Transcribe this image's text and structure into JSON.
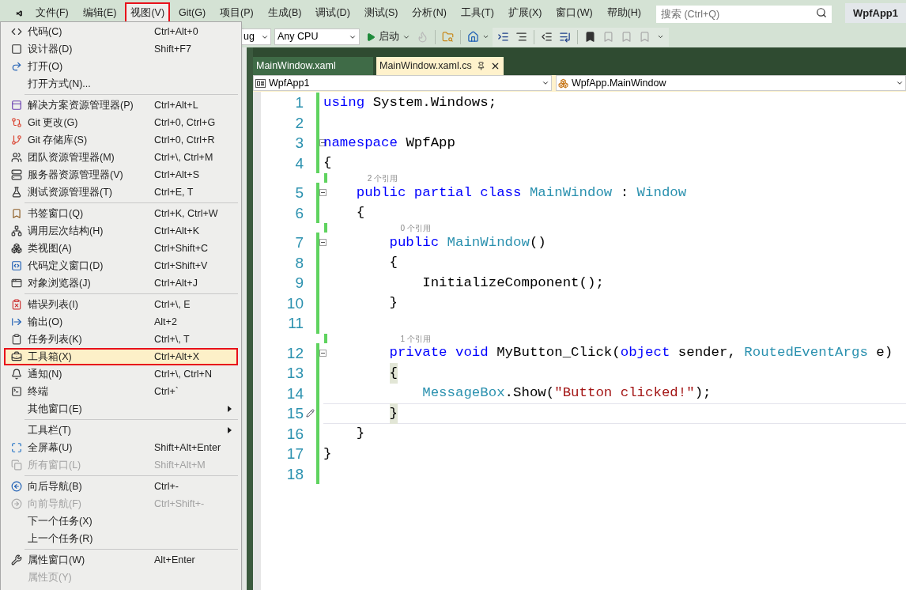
{
  "menubar": {
    "items": [
      {
        "label": "文件(F)",
        "selected": false
      },
      {
        "label": "编辑(E)",
        "selected": false
      },
      {
        "label": "视图(V)",
        "selected": true
      },
      {
        "label": "Git(G)",
        "selected": false
      },
      {
        "label": "项目(P)",
        "selected": false
      },
      {
        "label": "生成(B)",
        "selected": false
      },
      {
        "label": "调试(D)",
        "selected": false
      },
      {
        "label": "测试(S)",
        "selected": false
      },
      {
        "label": "分析(N)",
        "selected": false
      },
      {
        "label": "工具(T)",
        "selected": false
      },
      {
        "label": "扩展(X)",
        "selected": false
      },
      {
        "label": "窗口(W)",
        "selected": false
      },
      {
        "label": "帮助(H)",
        "selected": false
      }
    ],
    "search": {
      "placeholder": "搜索 (Ctrl+Q)"
    },
    "solution": "WpfApp1"
  },
  "toolbar": {
    "configuration": "ug",
    "platform": "Any CPU",
    "start": "启动"
  },
  "view_menu": {
    "items": [
      {
        "kind": "item",
        "label": "代码(C)",
        "shortcut": "Ctrl+Alt+0",
        "disabled": false,
        "selected": false
      },
      {
        "kind": "item",
        "label": "设计器(D)",
        "shortcut": "Shift+F7",
        "disabled": false,
        "selected": false
      },
      {
        "kind": "item",
        "label": "打开(O)",
        "disabled": false,
        "selected": false
      },
      {
        "kind": "item",
        "label": "打开方式(N)...",
        "disabled": false,
        "selected": false
      },
      {
        "kind": "separator"
      },
      {
        "kind": "item",
        "label": "解决方案资源管理器(P)",
        "shortcut": "Ctrl+Alt+L",
        "disabled": false,
        "selected": false
      },
      {
        "kind": "item",
        "label": "Git 更改(G)",
        "shortcut": "Ctrl+0, Ctrl+G",
        "disabled": false,
        "selected": false
      },
      {
        "kind": "item",
        "label": "Git 存储库(S)",
        "shortcut": "Ctrl+0, Ctrl+R",
        "disabled": false,
        "selected": false
      },
      {
        "kind": "item",
        "label": "团队资源管理器(M)",
        "shortcut": "Ctrl+\\, Ctrl+M",
        "disabled": false,
        "selected": false
      },
      {
        "kind": "item",
        "label": "服务器资源管理器(V)",
        "shortcut": "Ctrl+Alt+S",
        "disabled": false,
        "selected": false
      },
      {
        "kind": "item",
        "label": "测试资源管理器(T)",
        "shortcut": "Ctrl+E, T",
        "disabled": false,
        "selected": false
      },
      {
        "kind": "separator"
      },
      {
        "kind": "item",
        "label": "书签窗口(Q)",
        "shortcut": "Ctrl+K, Ctrl+W",
        "disabled": false,
        "selected": false
      },
      {
        "kind": "item",
        "label": "调用层次结构(H)",
        "shortcut": "Ctrl+Alt+K",
        "disabled": false,
        "selected": false
      },
      {
        "kind": "item",
        "label": "类视图(A)",
        "shortcut": "Ctrl+Shift+C",
        "disabled": false,
        "selected": false
      },
      {
        "kind": "item",
        "label": "代码定义窗口(D)",
        "shortcut": "Ctrl+Shift+V",
        "disabled": false,
        "selected": false
      },
      {
        "kind": "item",
        "label": "对象浏览器(J)",
        "shortcut": "Ctrl+Alt+J",
        "disabled": false,
        "selected": false
      },
      {
        "kind": "separator"
      },
      {
        "kind": "item",
        "label": "错误列表(I)",
        "shortcut": "Ctrl+\\, E",
        "disabled": false,
        "selected": false
      },
      {
        "kind": "item",
        "label": "输出(O)",
        "shortcut": "Alt+2",
        "disabled": false,
        "selected": false
      },
      {
        "kind": "item",
        "label": "任务列表(K)",
        "shortcut": "Ctrl+\\, T",
        "disabled": false,
        "selected": false
      },
      {
        "kind": "item",
        "label": "工具箱(X)",
        "shortcut": "Ctrl+Alt+X",
        "disabled": false,
        "selected": true
      },
      {
        "kind": "item",
        "label": "通知(N)",
        "shortcut": "Ctrl+\\, Ctrl+N",
        "disabled": false,
        "selected": false
      },
      {
        "kind": "item",
        "label": "终端",
        "shortcut": "Ctrl+`",
        "disabled": false,
        "selected": false
      },
      {
        "kind": "item",
        "label": "其他窗口(E)",
        "submenu": true,
        "disabled": false,
        "selected": false
      },
      {
        "kind": "separator"
      },
      {
        "kind": "item",
        "label": "工具栏(T)",
        "submenu": true,
        "disabled": false,
        "selected": false
      },
      {
        "kind": "item",
        "label": "全屏幕(U)",
        "shortcut": "Shift+Alt+Enter",
        "disabled": false,
        "selected": false
      },
      {
        "kind": "item",
        "label": "所有窗口(L)",
        "shortcut": "Shift+Alt+M",
        "disabled": true,
        "selected": false
      },
      {
        "kind": "separator"
      },
      {
        "kind": "item",
        "label": "向后导航(B)",
        "shortcut": "Ctrl+-",
        "disabled": false,
        "selected": false
      },
      {
        "kind": "item",
        "label": "向前导航(F)",
        "shortcut": "Ctrl+Shift+-",
        "disabled": true,
        "selected": false
      },
      {
        "kind": "item",
        "label": "下一个任务(X)",
        "disabled": false,
        "selected": false
      },
      {
        "kind": "item",
        "label": "上一个任务(R)",
        "disabled": false,
        "selected": false
      },
      {
        "kind": "separator"
      },
      {
        "kind": "item",
        "label": "属性窗口(W)",
        "shortcut": "Alt+Enter",
        "disabled": false,
        "selected": false
      },
      {
        "kind": "item",
        "label": "属性页(Y)",
        "disabled": true,
        "selected": false
      }
    ]
  },
  "tabs": [
    {
      "label": "MainWindow.xaml",
      "selected": false
    },
    {
      "label": "MainWindow.xaml.cs",
      "selected": true
    }
  ],
  "navigation": {
    "project": "WpfApp1",
    "type": "WpfApp.MainWindow"
  },
  "editor": {
    "lines": [
      {
        "number": "1",
        "tokens": [
          {
            "kind": "keyword",
            "text": "using"
          },
          {
            "kind": "plain",
            "text": " System.Windows;"
          }
        ]
      },
      {
        "number": "2"
      },
      {
        "number": "3",
        "foldable": true,
        "tokens": [
          {
            "kind": "keyword",
            "text": "namespace"
          },
          {
            "kind": "plain",
            "text": " WpfApp"
          }
        ]
      },
      {
        "number": "4",
        "tokens": [
          {
            "kind": "plain",
            "text": "{"
          }
        ]
      },
      {
        "number": "5",
        "foldable": true,
        "codelens": "2 个引用",
        "tokens": [
          {
            "kind": "keyword",
            "text": "    public partial class"
          },
          {
            "kind": "type",
            "text": " MainWindow"
          },
          {
            "kind": "plain",
            "text": " :"
          },
          {
            "kind": "type",
            "text": " Window"
          }
        ]
      },
      {
        "number": "6",
        "tokens": [
          {
            "kind": "plain",
            "text": "    {"
          }
        ]
      },
      {
        "number": "7",
        "foldable": true,
        "codelens": "0 个引用",
        "tokens": [
          {
            "kind": "keyword",
            "text": "        public"
          },
          {
            "kind": "type",
            "text": " MainWindow"
          },
          {
            "kind": "plain",
            "text": "()"
          }
        ]
      },
      {
        "number": "8",
        "tokens": [
          {
            "kind": "plain",
            "text": "        {"
          }
        ]
      },
      {
        "number": "9",
        "tokens": [
          {
            "kind": "plain",
            "text": "            InitializeComponent();"
          }
        ]
      },
      {
        "number": "10",
        "tokens": [
          {
            "kind": "plain",
            "text": "        }"
          }
        ]
      },
      {
        "number": "11"
      },
      {
        "number": "12",
        "foldable": true,
        "codelens": "1 个引用",
        "tokens": [
          {
            "kind": "keyword",
            "text": "        private void"
          },
          {
            "kind": "plain",
            "text": " MyButton_Click("
          },
          {
            "kind": "keyword",
            "text": "object"
          },
          {
            "kind": "plain",
            "text": " sender,"
          },
          {
            "kind": "type",
            "text": " RoutedEventArgs"
          },
          {
            "kind": "plain",
            "text": " e)"
          }
        ]
      },
      {
        "number": "13",
        "tokens": [
          {
            "kind": "brace-match",
            "text": "        {"
          }
        ]
      },
      {
        "number": "14",
        "tokens": [
          {
            "kind": "type",
            "text": "            MessageBox"
          },
          {
            "kind": "plain",
            "text": ".Show("
          },
          {
            "kind": "string",
            "text": "\"Button clicked!\""
          },
          {
            "kind": "plain",
            "text": ");"
          }
        ]
      },
      {
        "number": "15",
        "current": true,
        "tokens": [
          {
            "kind": "brace-match",
            "text": "        }"
          }
        ]
      },
      {
        "number": "16",
        "tokens": [
          {
            "kind": "plain",
            "text": "    }"
          }
        ]
      },
      {
        "number": "17",
        "tokens": [
          {
            "kind": "plain",
            "text": "}"
          }
        ]
      },
      {
        "number": "18"
      }
    ]
  }
}
